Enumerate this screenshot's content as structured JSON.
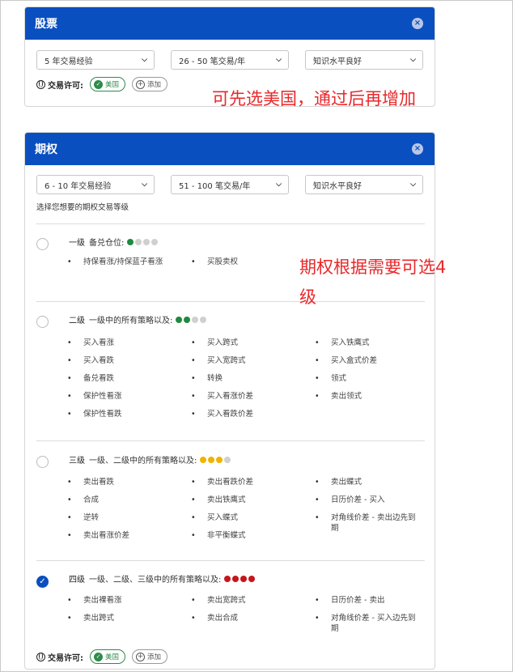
{
  "stocks": {
    "title": "股票",
    "close": "×",
    "dropdowns": [
      "5 年交易经验",
      "26 - 50 笔交易/年",
      "知识水平良好"
    ],
    "permit_label": "交易许可:",
    "chip_us": "美国",
    "chip_add": "添加"
  },
  "annotation_top": "可先选美国，通过后再增加",
  "options": {
    "title": "期权",
    "close": "×",
    "dropdowns": [
      "6 - 10 年交易经验",
      "51 - 100 笔交易/年",
      "知识水平良好"
    ],
    "select_label": "选择您想要的期权交易等级",
    "levels": [
      {
        "name": "一级",
        "desc": "备兑仓位:",
        "checked": false,
        "dots": [
          "green",
          "gray",
          "gray",
          "gray"
        ],
        "items": [
          "持保看涨/持保蓝子看涨",
          "买股卖权"
        ]
      },
      {
        "name": "二级",
        "desc": "一级中的所有策略以及:",
        "checked": false,
        "dots": [
          "green",
          "green",
          "gray",
          "gray"
        ],
        "items": [
          "买入看涨",
          "买入跨式",
          "买入铁鹰式",
          "买入看跌",
          "买入宽跨式",
          "买入盒式价差",
          "备兑看跌",
          "转换",
          "领式",
          "保护性看涨",
          "买入看涨价差",
          "卖出领式",
          "保护性看跌",
          "买入看跌价差"
        ]
      },
      {
        "name": "三级",
        "desc": "一级、二级中的所有策略以及:",
        "checked": false,
        "dots": [
          "yellow",
          "yellow",
          "yellow",
          "gray"
        ],
        "items": [
          "卖出看跌",
          "卖出看跌价差",
          "卖出蝶式",
          "合成",
          "卖出铁鹰式",
          "日历价差 - 买入",
          "逆转",
          "买入蝶式",
          "对角线价差 - 卖出边先到期",
          "卖出看涨价差",
          "非平衡蝶式"
        ]
      },
      {
        "name": "四级",
        "desc": "一级、二级、三级中的所有策略以及:",
        "checked": true,
        "dots": [
          "red",
          "red",
          "red",
          "red"
        ],
        "items": [
          "卖出裸看涨",
          "卖出宽跨式",
          "日历价差 - 卖出",
          "卖出跨式",
          "卖出合成",
          "对角线价差 - 买入边先到期"
        ]
      }
    ],
    "permit_label": "交易许可:",
    "chip_us": "美国",
    "chip_add": "添加"
  },
  "annotation_mid_1": "期权根据需要可选4",
  "annotation_mid_2": "级"
}
